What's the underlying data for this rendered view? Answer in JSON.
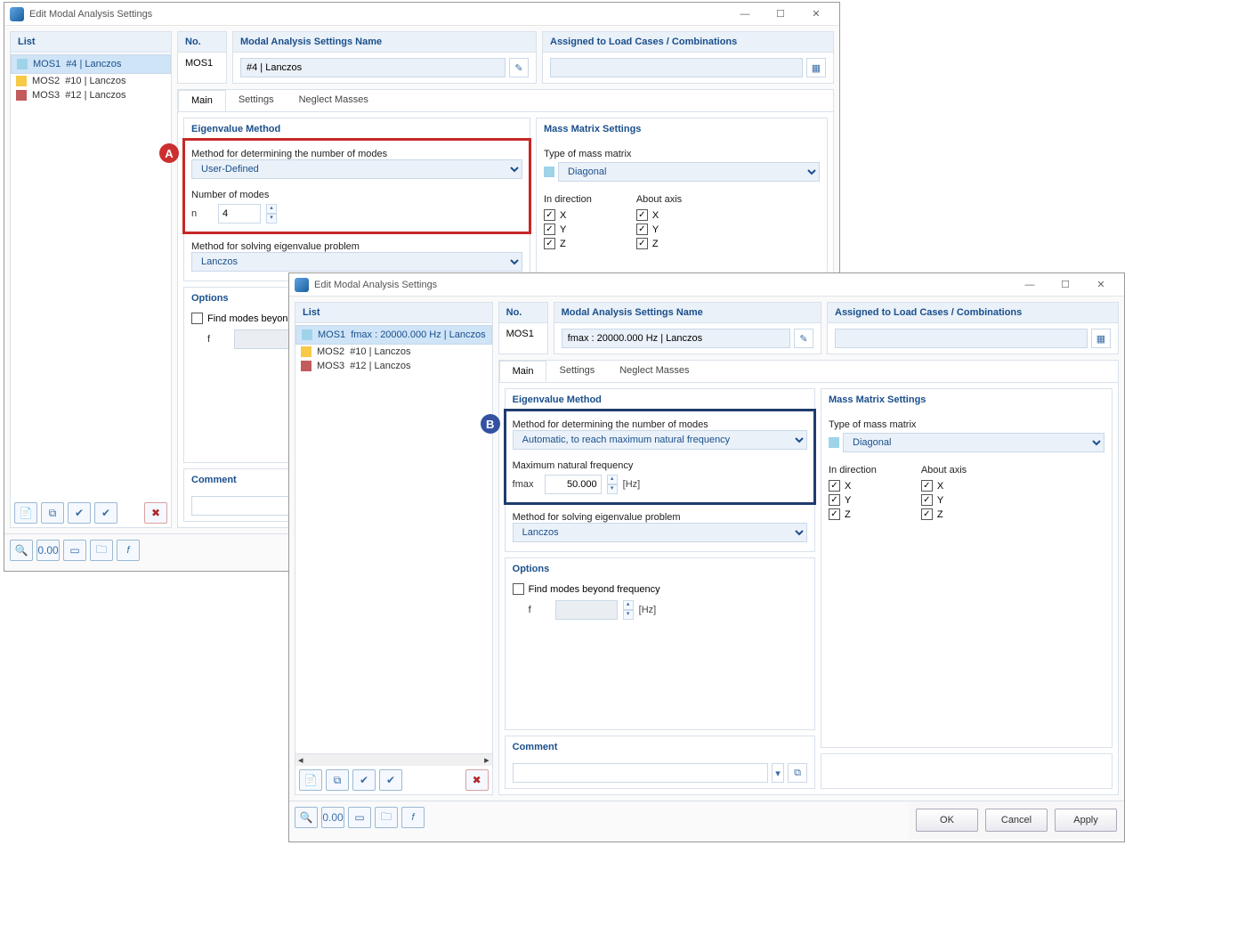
{
  "winA": {
    "title": "Edit Modal Analysis Settings",
    "list_head": "List",
    "items": [
      {
        "id": "MOS1",
        "label": "#4 | Lanczos",
        "color": "blue",
        "selected": true
      },
      {
        "id": "MOS2",
        "label": "#10 | Lanczos",
        "color": "yellow"
      },
      {
        "id": "MOS3",
        "label": "#12 | Lanczos",
        "color": "red"
      }
    ],
    "no_head": "No.",
    "no_value": "MOS1",
    "name_head": "Modal Analysis Settings Name",
    "name_value": "#4 | Lanczos",
    "assigned_head": "Assigned to Load Cases / Combinations",
    "tabs": [
      "Main",
      "Settings",
      "Neglect Masses"
    ],
    "eigen": {
      "title": "Eigenvalue Method",
      "method_label": "Method for determining the number of modes",
      "method_value": "User-Defined",
      "modes_label": "Number of modes",
      "modes_sym": "n",
      "modes_value": "4",
      "solver_label": "Method for solving eigenvalue problem",
      "solver_value": "Lanczos"
    },
    "options": {
      "title": "Options",
      "find_label": "Find modes beyond frequency",
      "f_sym": "f"
    },
    "mass": {
      "title": "Mass Matrix Settings",
      "type_label": "Type of mass matrix",
      "type_value": "Diagonal",
      "dir_head": "In direction",
      "axis_head": "About axis",
      "x": "X",
      "y": "Y",
      "z": "Z"
    },
    "comment": "Comment"
  },
  "winB": {
    "title": "Edit Modal Analysis Settings",
    "list_head": "List",
    "items": [
      {
        "id": "MOS1",
        "label": "fmax : 20000.000 Hz | Lanczos",
        "color": "blue",
        "selected": true
      },
      {
        "id": "MOS2",
        "label": "#10 | Lanczos",
        "color": "yellow"
      },
      {
        "id": "MOS3",
        "label": "#12 | Lanczos",
        "color": "red"
      }
    ],
    "no_head": "No.",
    "no_value": "MOS1",
    "name_head": "Modal Analysis Settings Name",
    "name_value": "fmax : 20000.000 Hz | Lanczos",
    "assigned_head": "Assigned to Load Cases / Combinations",
    "tabs": [
      "Main",
      "Settings",
      "Neglect Masses"
    ],
    "eigen": {
      "title": "Eigenvalue Method",
      "method_label": "Method for determining the number of modes",
      "method_value": "Automatic, to reach maximum natural frequency",
      "maxfreq_label": "Maximum natural frequency",
      "maxfreq_sym": "fmax",
      "maxfreq_value": "50.000",
      "maxfreq_unit": "[Hz]",
      "solver_label": "Method for solving eigenvalue problem",
      "solver_value": "Lanczos"
    },
    "options": {
      "title": "Options",
      "find_label": "Find modes beyond frequency",
      "f_sym": "f",
      "f_unit": "[Hz]"
    },
    "mass": {
      "title": "Mass Matrix Settings",
      "type_label": "Type of mass matrix",
      "type_value": "Diagonal",
      "dir_head": "In direction",
      "axis_head": "About axis",
      "x": "X",
      "y": "Y",
      "z": "Z"
    },
    "comment": "Comment",
    "buttons": {
      "ok": "OK",
      "cancel": "Cancel",
      "apply": "Apply"
    }
  },
  "badges": {
    "a": "A",
    "b": "B"
  }
}
